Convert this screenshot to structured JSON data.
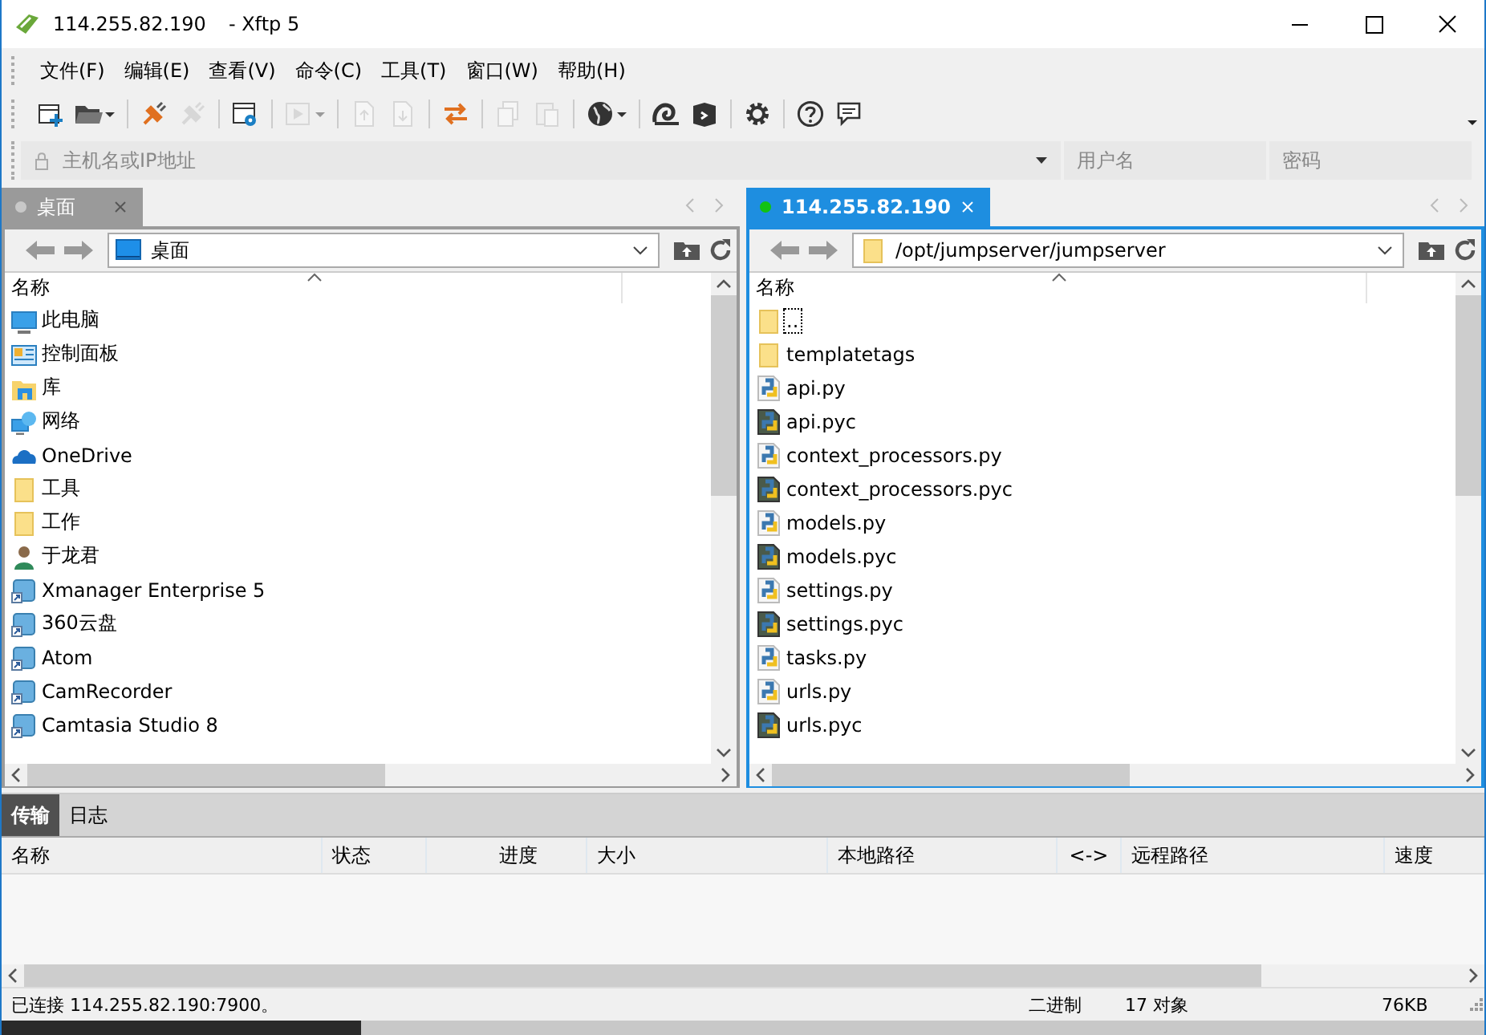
{
  "window": {
    "title": "114.255.82.190",
    "app": "- Xftp 5"
  },
  "menu": [
    "文件(F)",
    "编辑(E)",
    "查看(V)",
    "命令(C)",
    "工具(T)",
    "窗口(W)",
    "帮助(H)"
  ],
  "toolbar": [
    {
      "kind": "new",
      "disabled": false,
      "dropdown": false
    },
    {
      "kind": "open",
      "disabled": false,
      "dropdown": true
    },
    {
      "kind": "sep"
    },
    {
      "kind": "connect",
      "disabled": false,
      "dropdown": false
    },
    {
      "kind": "disconnect",
      "disabled": true,
      "dropdown": false
    },
    {
      "kind": "sep"
    },
    {
      "kind": "properties",
      "disabled": false,
      "dropdown": false
    },
    {
      "kind": "sep"
    },
    {
      "kind": "play",
      "disabled": true,
      "dropdown": true
    },
    {
      "kind": "sep"
    },
    {
      "kind": "upload",
      "disabled": true,
      "dropdown": false
    },
    {
      "kind": "download",
      "disabled": true,
      "dropdown": false
    },
    {
      "kind": "sep"
    },
    {
      "kind": "transfer",
      "disabled": false,
      "dropdown": false
    },
    {
      "kind": "sep"
    },
    {
      "kind": "copy",
      "disabled": true,
      "dropdown": false
    },
    {
      "kind": "paste",
      "disabled": true,
      "dropdown": false
    },
    {
      "kind": "sep"
    },
    {
      "kind": "globe",
      "disabled": false,
      "dropdown": true
    },
    {
      "kind": "sep"
    },
    {
      "kind": "shell",
      "disabled": false,
      "dropdown": false
    },
    {
      "kind": "terminal",
      "disabled": false,
      "dropdown": false
    },
    {
      "kind": "sep"
    },
    {
      "kind": "settings",
      "disabled": false,
      "dropdown": false
    },
    {
      "kind": "sep"
    },
    {
      "kind": "help",
      "disabled": false,
      "dropdown": false
    },
    {
      "kind": "chat",
      "disabled": false,
      "dropdown": false
    }
  ],
  "address_bar": {
    "host_placeholder": "主机名或IP地址",
    "user_placeholder": "用户名",
    "password_placeholder": "密码"
  },
  "panes": [
    {
      "active": false,
      "tabs": [
        {
          "label": "桌面",
          "selected": true,
          "connected": false
        }
      ],
      "location": {
        "text": "桌面",
        "kind": "desktop"
      },
      "column": "名称",
      "files": [
        {
          "name": "此电脑",
          "kind": "computer",
          "focused": false
        },
        {
          "name": "控制面板",
          "kind": "control-panel",
          "focused": false
        },
        {
          "name": "库",
          "kind": "library",
          "focused": false
        },
        {
          "name": "网络",
          "kind": "network",
          "focused": false
        },
        {
          "name": "OneDrive",
          "kind": "cloud",
          "focused": false
        },
        {
          "name": "工具",
          "kind": "folder",
          "focused": false
        },
        {
          "name": "工作",
          "kind": "folder",
          "focused": false
        },
        {
          "name": "于龙君",
          "kind": "user",
          "focused": false
        },
        {
          "name": "Xmanager Enterprise 5",
          "kind": "shortcut",
          "focused": false
        },
        {
          "name": "360云盘",
          "kind": "shortcut",
          "focused": false
        },
        {
          "name": "Atom",
          "kind": "shortcut",
          "focused": false
        },
        {
          "name": "CamRecorder",
          "kind": "shortcut",
          "focused": false
        },
        {
          "name": "Camtasia Studio 8",
          "kind": "shortcut",
          "focused": false
        }
      ]
    },
    {
      "active": true,
      "tabs": [
        {
          "label": "114.255.82.190",
          "selected": true,
          "connected": true
        }
      ],
      "location": {
        "text": "/opt/jumpserver/jumpserver",
        "kind": "folder"
      },
      "column": "名称",
      "files": [
        {
          "name": "..",
          "kind": "folder",
          "focused": true
        },
        {
          "name": "templatetags",
          "kind": "folder",
          "focused": false
        },
        {
          "name": "api.py",
          "kind": "py",
          "focused": false
        },
        {
          "name": "api.pyc",
          "kind": "pyc",
          "focused": false
        },
        {
          "name": "context_processors.py",
          "kind": "py",
          "focused": false
        },
        {
          "name": "context_processors.pyc",
          "kind": "pyc",
          "focused": false
        },
        {
          "name": "models.py",
          "kind": "py",
          "focused": false
        },
        {
          "name": "models.pyc",
          "kind": "pyc",
          "focused": false
        },
        {
          "name": "settings.py",
          "kind": "py",
          "focused": false
        },
        {
          "name": "settings.pyc",
          "kind": "pyc",
          "focused": false
        },
        {
          "name": "tasks.py",
          "kind": "py",
          "focused": false
        },
        {
          "name": "urls.py",
          "kind": "py",
          "focused": false
        },
        {
          "name": "urls.pyc",
          "kind": "pyc",
          "focused": false
        }
      ]
    }
  ],
  "transfer": {
    "tabs": [
      {
        "label": "传输",
        "selected": true
      },
      {
        "label": "日志",
        "selected": false
      }
    ],
    "columns": [
      "名称",
      "状态",
      "进度",
      "大小",
      "本地路径",
      "<->",
      "远程路径",
      "速度"
    ]
  },
  "status_bar": {
    "message": "已连接 114.255.82.190:7900。",
    "mode": "二进制",
    "objects": "17 对象",
    "size": "76KB"
  }
}
